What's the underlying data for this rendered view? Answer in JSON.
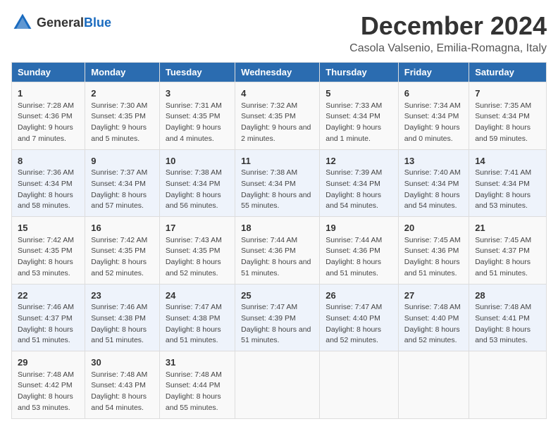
{
  "logo": {
    "general": "General",
    "blue": "Blue"
  },
  "header": {
    "month_year": "December 2024",
    "location": "Casola Valsenio, Emilia-Romagna, Italy"
  },
  "columns": [
    "Sunday",
    "Monday",
    "Tuesday",
    "Wednesday",
    "Thursday",
    "Friday",
    "Saturday"
  ],
  "weeks": [
    [
      {
        "day": "1",
        "sunrise": "Sunrise: 7:28 AM",
        "sunset": "Sunset: 4:36 PM",
        "daylight": "Daylight: 9 hours and 7 minutes."
      },
      {
        "day": "2",
        "sunrise": "Sunrise: 7:30 AM",
        "sunset": "Sunset: 4:35 PM",
        "daylight": "Daylight: 9 hours and 5 minutes."
      },
      {
        "day": "3",
        "sunrise": "Sunrise: 7:31 AM",
        "sunset": "Sunset: 4:35 PM",
        "daylight": "Daylight: 9 hours and 4 minutes."
      },
      {
        "day": "4",
        "sunrise": "Sunrise: 7:32 AM",
        "sunset": "Sunset: 4:35 PM",
        "daylight": "Daylight: 9 hours and 2 minutes."
      },
      {
        "day": "5",
        "sunrise": "Sunrise: 7:33 AM",
        "sunset": "Sunset: 4:34 PM",
        "daylight": "Daylight: 9 hours and 1 minute."
      },
      {
        "day": "6",
        "sunrise": "Sunrise: 7:34 AM",
        "sunset": "Sunset: 4:34 PM",
        "daylight": "Daylight: 9 hours and 0 minutes."
      },
      {
        "day": "7",
        "sunrise": "Sunrise: 7:35 AM",
        "sunset": "Sunset: 4:34 PM",
        "daylight": "Daylight: 8 hours and 59 minutes."
      }
    ],
    [
      {
        "day": "8",
        "sunrise": "Sunrise: 7:36 AM",
        "sunset": "Sunset: 4:34 PM",
        "daylight": "Daylight: 8 hours and 58 minutes."
      },
      {
        "day": "9",
        "sunrise": "Sunrise: 7:37 AM",
        "sunset": "Sunset: 4:34 PM",
        "daylight": "Daylight: 8 hours and 57 minutes."
      },
      {
        "day": "10",
        "sunrise": "Sunrise: 7:38 AM",
        "sunset": "Sunset: 4:34 PM",
        "daylight": "Daylight: 8 hours and 56 minutes."
      },
      {
        "day": "11",
        "sunrise": "Sunrise: 7:38 AM",
        "sunset": "Sunset: 4:34 PM",
        "daylight": "Daylight: 8 hours and 55 minutes."
      },
      {
        "day": "12",
        "sunrise": "Sunrise: 7:39 AM",
        "sunset": "Sunset: 4:34 PM",
        "daylight": "Daylight: 8 hours and 54 minutes."
      },
      {
        "day": "13",
        "sunrise": "Sunrise: 7:40 AM",
        "sunset": "Sunset: 4:34 PM",
        "daylight": "Daylight: 8 hours and 54 minutes."
      },
      {
        "day": "14",
        "sunrise": "Sunrise: 7:41 AM",
        "sunset": "Sunset: 4:34 PM",
        "daylight": "Daylight: 8 hours and 53 minutes."
      }
    ],
    [
      {
        "day": "15",
        "sunrise": "Sunrise: 7:42 AM",
        "sunset": "Sunset: 4:35 PM",
        "daylight": "Daylight: 8 hours and 53 minutes."
      },
      {
        "day": "16",
        "sunrise": "Sunrise: 7:42 AM",
        "sunset": "Sunset: 4:35 PM",
        "daylight": "Daylight: 8 hours and 52 minutes."
      },
      {
        "day": "17",
        "sunrise": "Sunrise: 7:43 AM",
        "sunset": "Sunset: 4:35 PM",
        "daylight": "Daylight: 8 hours and 52 minutes."
      },
      {
        "day": "18",
        "sunrise": "Sunrise: 7:44 AM",
        "sunset": "Sunset: 4:36 PM",
        "daylight": "Daylight: 8 hours and 51 minutes."
      },
      {
        "day": "19",
        "sunrise": "Sunrise: 7:44 AM",
        "sunset": "Sunset: 4:36 PM",
        "daylight": "Daylight: 8 hours and 51 minutes."
      },
      {
        "day": "20",
        "sunrise": "Sunrise: 7:45 AM",
        "sunset": "Sunset: 4:36 PM",
        "daylight": "Daylight: 8 hours and 51 minutes."
      },
      {
        "day": "21",
        "sunrise": "Sunrise: 7:45 AM",
        "sunset": "Sunset: 4:37 PM",
        "daylight": "Daylight: 8 hours and 51 minutes."
      }
    ],
    [
      {
        "day": "22",
        "sunrise": "Sunrise: 7:46 AM",
        "sunset": "Sunset: 4:37 PM",
        "daylight": "Daylight: 8 hours and 51 minutes."
      },
      {
        "day": "23",
        "sunrise": "Sunrise: 7:46 AM",
        "sunset": "Sunset: 4:38 PM",
        "daylight": "Daylight: 8 hours and 51 minutes."
      },
      {
        "day": "24",
        "sunrise": "Sunrise: 7:47 AM",
        "sunset": "Sunset: 4:38 PM",
        "daylight": "Daylight: 8 hours and 51 minutes."
      },
      {
        "day": "25",
        "sunrise": "Sunrise: 7:47 AM",
        "sunset": "Sunset: 4:39 PM",
        "daylight": "Daylight: 8 hours and 51 minutes."
      },
      {
        "day": "26",
        "sunrise": "Sunrise: 7:47 AM",
        "sunset": "Sunset: 4:40 PM",
        "daylight": "Daylight: 8 hours and 52 minutes."
      },
      {
        "day": "27",
        "sunrise": "Sunrise: 7:48 AM",
        "sunset": "Sunset: 4:40 PM",
        "daylight": "Daylight: 8 hours and 52 minutes."
      },
      {
        "day": "28",
        "sunrise": "Sunrise: 7:48 AM",
        "sunset": "Sunset: 4:41 PM",
        "daylight": "Daylight: 8 hours and 53 minutes."
      }
    ],
    [
      {
        "day": "29",
        "sunrise": "Sunrise: 7:48 AM",
        "sunset": "Sunset: 4:42 PM",
        "daylight": "Daylight: 8 hours and 53 minutes."
      },
      {
        "day": "30",
        "sunrise": "Sunrise: 7:48 AM",
        "sunset": "Sunset: 4:43 PM",
        "daylight": "Daylight: 8 hours and 54 minutes."
      },
      {
        "day": "31",
        "sunrise": "Sunrise: 7:48 AM",
        "sunset": "Sunset: 4:44 PM",
        "daylight": "Daylight: 8 hours and 55 minutes."
      },
      {
        "day": "",
        "sunrise": "",
        "sunset": "",
        "daylight": ""
      },
      {
        "day": "",
        "sunrise": "",
        "sunset": "",
        "daylight": ""
      },
      {
        "day": "",
        "sunrise": "",
        "sunset": "",
        "daylight": ""
      },
      {
        "day": "",
        "sunrise": "",
        "sunset": "",
        "daylight": ""
      }
    ]
  ]
}
